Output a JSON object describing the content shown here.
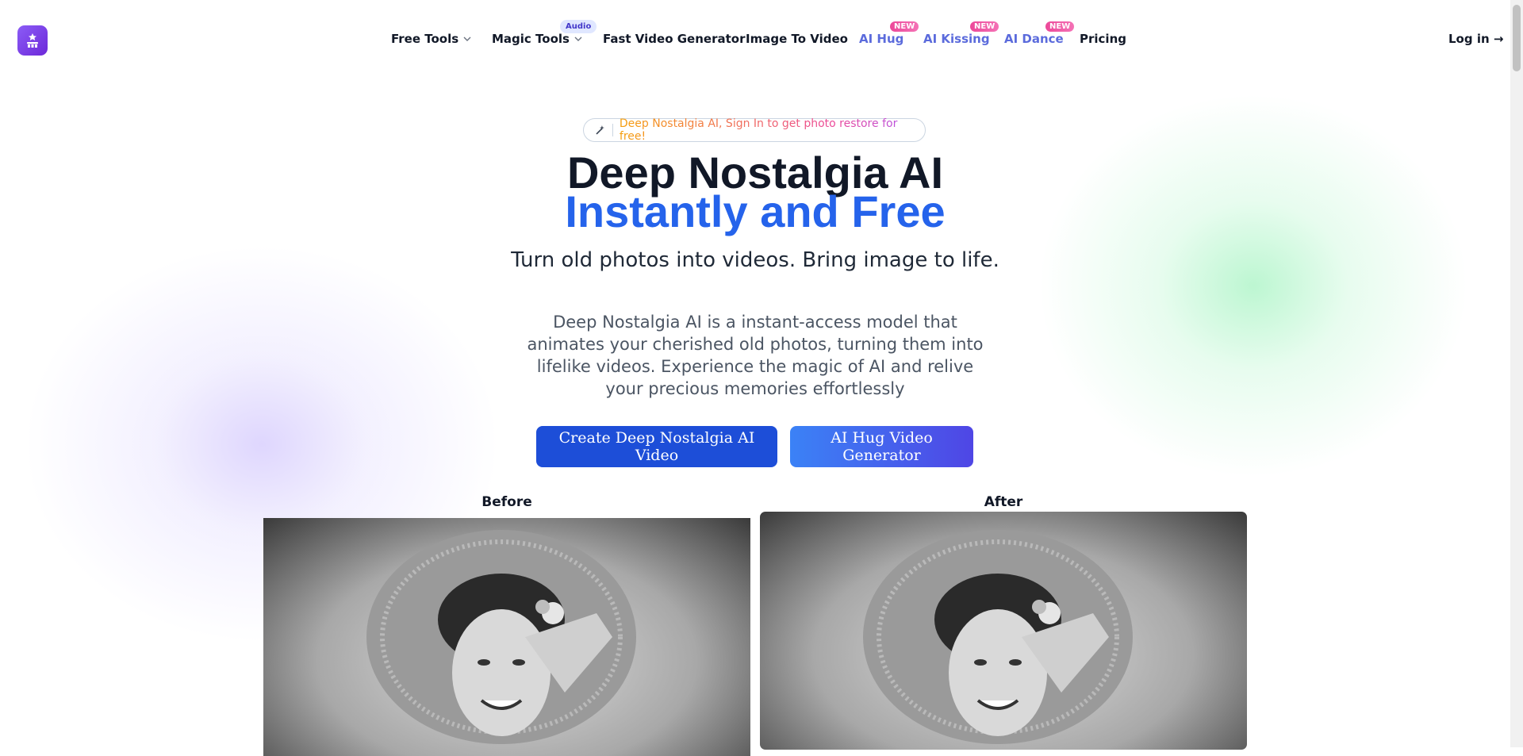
{
  "header": {
    "nav": [
      {
        "label": "Free Tools",
        "dropdown": true
      },
      {
        "label": "Magic Tools",
        "dropdown": true,
        "badge": "Audio"
      },
      {
        "label": "Fast Video Generator"
      },
      {
        "label": "Image To Video"
      },
      {
        "label": "AI Hug",
        "badge": "NEW"
      },
      {
        "label": "AI Kissing",
        "badge": "NEW"
      },
      {
        "label": "AI Dance",
        "badge": "NEW"
      },
      {
        "label": "Pricing"
      }
    ],
    "login": "Log in →"
  },
  "hero": {
    "pill_icon": "magic-wand-icon",
    "pill_text": "Deep Nostalgia AI, Sign In to get photo restore for free!",
    "title_line1": "Deep Nostalgia AI",
    "title_line2": "Instantly and Free",
    "subtitle": "Turn old photos into videos. Bring image to life.",
    "description": "Deep Nostalgia AI is a instant-access model that animates your cherished old photos, turning them into lifelike videos. Experience the magic of AI and relive your precious memories effortlessly",
    "primary_button": "Create Deep Nostalgia AI Video",
    "secondary_button": "AI Hug Video Generator"
  },
  "compare": {
    "before_label": "Before",
    "after_label": "After"
  },
  "colors": {
    "accent_blue": "#2563eb",
    "logo_purple": "#7c3aed",
    "nav_accent": "#5b6bdc",
    "badge_pink": "#ec4899"
  }
}
